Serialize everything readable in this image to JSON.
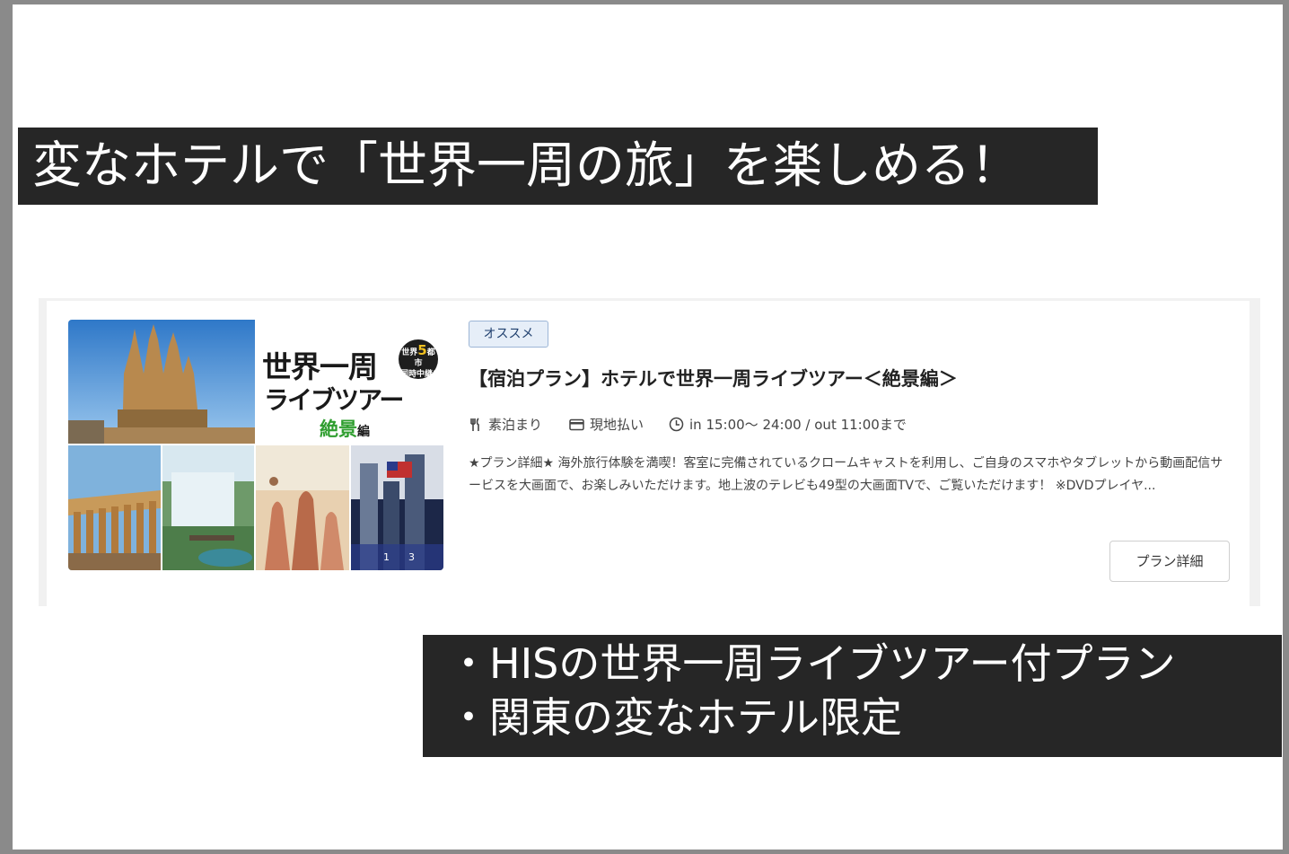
{
  "headline": "変なホテルで「世界一周の旅」を楽しめる！",
  "card": {
    "tag": "オススメ",
    "title": "【宿泊プラン】ホテルで世界一周ライブツアー＜絶景編＞",
    "meta": {
      "meal": "素泊まり",
      "payment": "現地払い",
      "time": "in 15:00～ 24:00 / out 11:00まで"
    },
    "description": "★プラン詳細★ 海外旅行体験を満喫！客室に完備されているクロームキャストを利用し、ご自身のスマホやタブレットから動画配信サービスを大画面で、お楽しみいただけます。地上波のテレビも49型の大画面TVで、ご覧いただけます！ ※DVDプレイヤ...",
    "detail_button": "プラン詳細",
    "image": {
      "title_line1": "世界一周",
      "title_line2": "ライブツアー",
      "title_line3": "絶景",
      "title_line3_suffix": "編",
      "badge_top": "世界",
      "badge_num": "5",
      "badge_unit": "都市",
      "badge_bottom": "同時中継!",
      "pager_1": "1",
      "pager_3": "3"
    }
  },
  "bullets": [
    "・HISの世界一周ライブツアー付プラン",
    "・関東の変なホテル限定"
  ],
  "colors": {
    "dark_band": "#262626",
    "tag_bg": "#e6eef8",
    "green_text": "#2f9e2f"
  }
}
